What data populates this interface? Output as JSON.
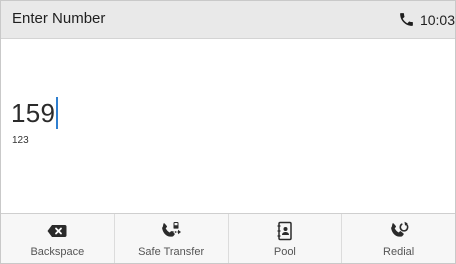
{
  "header": {
    "title": "Enter Number",
    "time": "10:03"
  },
  "entry": {
    "number": "159",
    "input_mode": "123"
  },
  "softkeys": [
    {
      "label": "Backspace",
      "icon": "backspace-icon"
    },
    {
      "label": "Safe Transfer",
      "icon": "safe-transfer-icon"
    },
    {
      "label": "Pool",
      "icon": "pool-icon"
    },
    {
      "label": "Redial",
      "icon": "redial-icon"
    }
  ],
  "colors": {
    "title_bar": "#e9e9e9",
    "cursor": "#2f7fd0",
    "icon": "#2b2b2b"
  }
}
